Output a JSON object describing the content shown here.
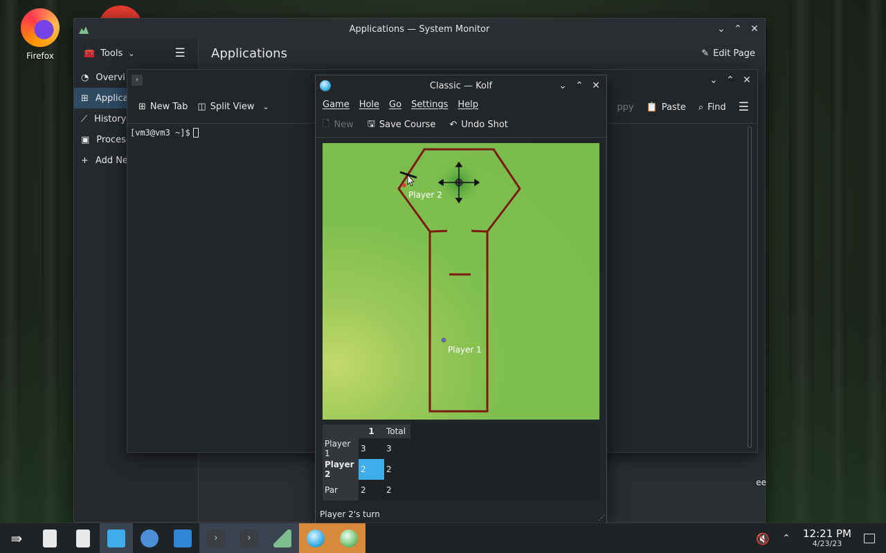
{
  "desktop": {
    "firefox_label": "Firefox"
  },
  "sysmon": {
    "title": "Applications — System Monitor",
    "tools_label": "Tools",
    "header": "Applications",
    "edit_page": "Edit Page",
    "sidebar": [
      "Overvi",
      "Applica",
      "History",
      "Proces",
      "Add Ne"
    ]
  },
  "konsole": {
    "new_tab": "New Tab",
    "split_view": "Split View",
    "copy": "ppy",
    "paste": "Paste",
    "find": "Find",
    "prompt": "[vm3@vm3 ~]$",
    "peek_text": "ee"
  },
  "kolf": {
    "title": "Classic — Kolf",
    "menu": [
      "Game",
      "Hole",
      "Go",
      "Settings",
      "Help"
    ],
    "toolbar": {
      "new": "New",
      "save": "Save Course",
      "undo": "Undo Shot"
    },
    "players": {
      "p1": "Player 1",
      "p2": "Player 2"
    },
    "score": {
      "header": [
        "1",
        "Total"
      ],
      "rows": [
        {
          "label": "Player 1",
          "hole": "3",
          "total": "3"
        },
        {
          "label": "Player 2",
          "hole": "2",
          "total": "2"
        },
        {
          "label": "Par",
          "hole": "2",
          "total": "2"
        }
      ]
    },
    "status": "Player 2's turn"
  },
  "taskbar": {
    "time": "12:21 PM",
    "date": "4/23/23"
  },
  "colors": {
    "accent": "#3daee9",
    "wall": "#7a1a10",
    "grass": "#78bc4b",
    "taskbar_highlight": "#d68a3a"
  }
}
